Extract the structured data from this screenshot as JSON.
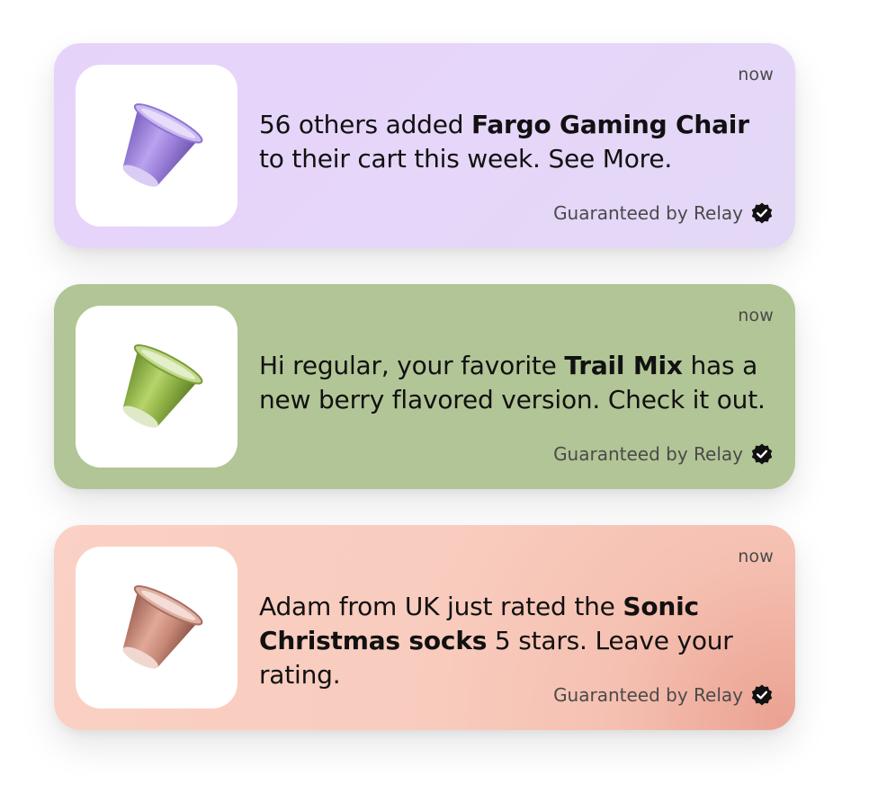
{
  "notifications": [
    {
      "product_icon": "coffee-capsule-icon",
      "capsule_color": "#9b7fd6",
      "time": "now",
      "text_before": "56 others added ",
      "product": "Fargo Gaming Chair",
      "text_after": " to their cart this week. See More.",
      "guarantee_text": "Guaranteed by Relay",
      "badge_icon": "verified-badge-icon"
    },
    {
      "product_icon": "coffee-capsule-icon",
      "capsule_color": "#8fb045",
      "time": "now",
      "text_before": "Hi regular, your favorite ",
      "product": "Trail Mix",
      "text_after": " has a new berry flavored version. Check it out.",
      "guarantee_text": "Guaranteed by Relay",
      "badge_icon": "verified-badge-icon"
    },
    {
      "product_icon": "coffee-capsule-icon",
      "capsule_color": "#c98a78",
      "time": "now",
      "text_before": "Adam from UK just rated the ",
      "product": "Sonic Christmas socks",
      "text_after": " 5 stars. Leave your rating.",
      "guarantee_text": "Guaranteed by Relay",
      "badge_icon": "verified-badge-icon"
    }
  ]
}
